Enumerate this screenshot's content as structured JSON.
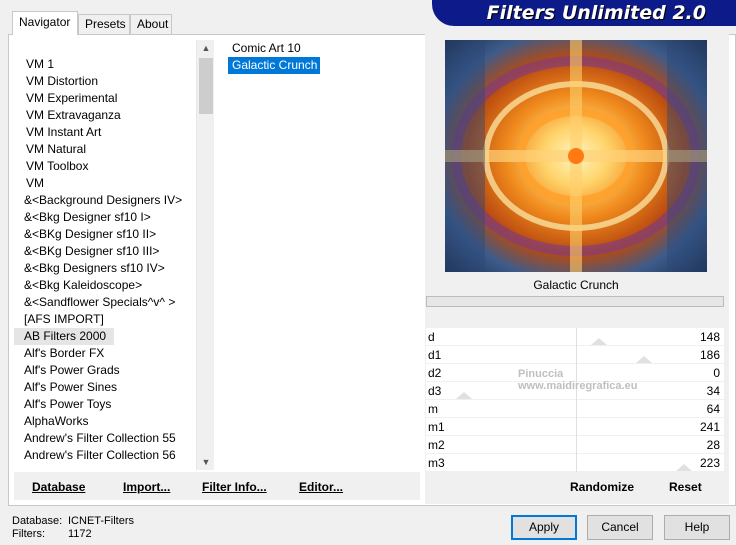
{
  "title_banner": "Filters Unlimited 2.0",
  "tabs": [
    {
      "label": "Navigator",
      "active": true
    },
    {
      "label": "Presets",
      "active": false
    },
    {
      "label": "About",
      "active": false
    }
  ],
  "categories": [
    "VM 1",
    "VM Distortion",
    "VM Experimental",
    "VM Extravaganza",
    "VM Instant Art",
    "VM Natural",
    "VM Toolbox",
    "VM",
    "&<Background Designers IV>",
    "&<Bkg Designer sf10 I>",
    "&<BKg Designer sf10 II>",
    "&<BKg Designer sf10 III>",
    "&<Bkg Designers sf10 IV>",
    "&<Bkg Kaleidoscope>",
    "&<Sandflower Specials^v^ >",
    "[AFS IMPORT]",
    "AB Filters 2000",
    "Alf's Border FX",
    "Alf's Power Grads",
    "Alf's Power Sines",
    "Alf's Power Toys",
    "AlphaWorks",
    "Andrew's Filter Collection 55",
    "Andrew's Filter Collection 56"
  ],
  "selected_category": "AB Filters 2000",
  "filters": [
    "Comic Art 10",
    "Galactic Crunch"
  ],
  "selected_filter": "Galactic Crunch",
  "preview_label": "Galactic Crunch",
  "params": [
    {
      "name": "d",
      "value": "148"
    },
    {
      "name": "d1",
      "value": "186"
    },
    {
      "name": "d2",
      "value": "0"
    },
    {
      "name": "d3",
      "value": "34"
    },
    {
      "name": "m",
      "value": "64"
    },
    {
      "name": "m1",
      "value": "241"
    },
    {
      "name": "m2",
      "value": "28"
    },
    {
      "name": "m3",
      "value": "223"
    }
  ],
  "watermark": {
    "line1": "Pinuccia",
    "line2": "www.maidiregrafica.eu"
  },
  "buttons": {
    "database": "Database",
    "import": "Import...",
    "filter_info": "Filter Info...",
    "editor": "Editor...",
    "randomize": "Randomize",
    "reset": "Reset",
    "apply": "Apply",
    "cancel": "Cancel",
    "help": "Help"
  },
  "footer": {
    "database_label": "Database:",
    "database_value": "ICNET-Filters",
    "filters_label": "Filters:",
    "filters_value": "1172"
  }
}
